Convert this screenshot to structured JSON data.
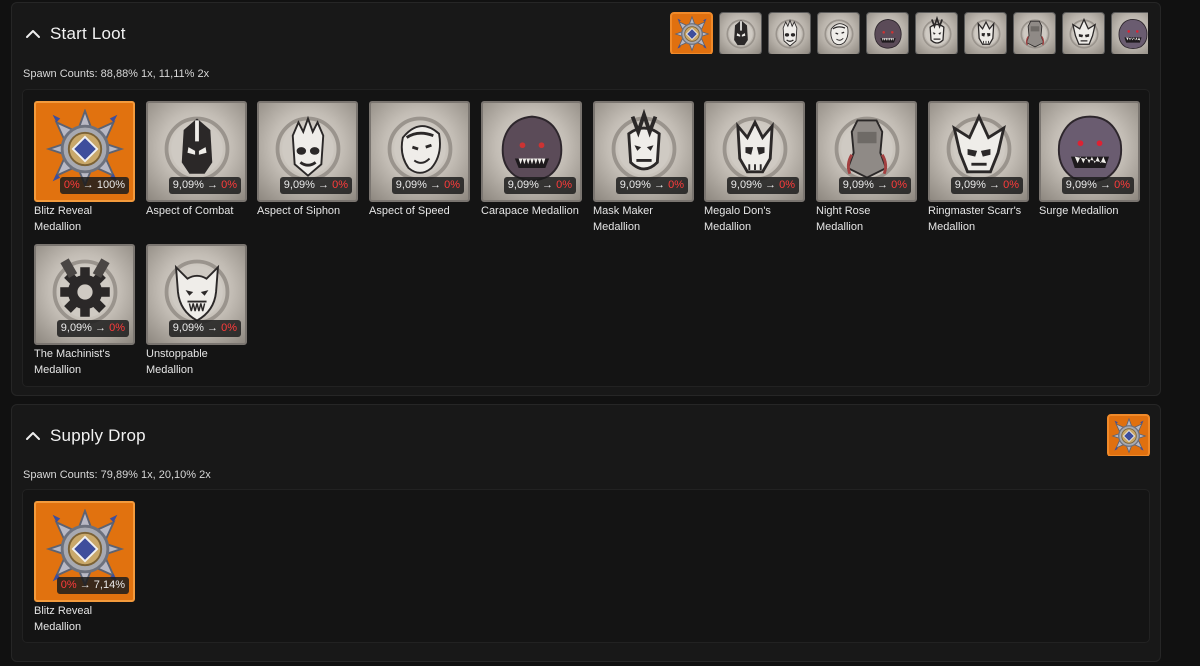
{
  "start_loot": {
    "title": "Start Loot",
    "spawn_counts": "Spawn Counts: 88,88% 1x, 11,11% 2x",
    "thumbs": [
      {
        "icon": "blitz-reveal-medallion-icon",
        "selected": true
      },
      {
        "icon": "aspect-of-combat-icon"
      },
      {
        "icon": "aspect-of-siphon-icon"
      },
      {
        "icon": "aspect-of-speed-icon"
      },
      {
        "icon": "carapace-medallion-icon"
      },
      {
        "icon": "mask-maker-medallion-icon"
      },
      {
        "icon": "megalo-dons-medallion-icon"
      },
      {
        "icon": "night-rose-medallion-icon"
      },
      {
        "icon": "ringmaster-scarrs-medallion-icon"
      },
      {
        "icon": "surge-medallion-icon"
      }
    ],
    "items": [
      {
        "name": "Blitz Reveal Medallion",
        "from": "0%",
        "arrow": "→",
        "to": "100%",
        "icon": "blitz-reveal-medallion-icon",
        "highlight": true
      },
      {
        "name": "Aspect of Combat",
        "from": "9,09%",
        "arrow": "→",
        "to": "0%",
        "icon": "aspect-of-combat-icon"
      },
      {
        "name": "Aspect of Siphon",
        "from": "9,09%",
        "arrow": "→",
        "to": "0%",
        "icon": "aspect-of-siphon-icon"
      },
      {
        "name": "Aspect of Speed",
        "from": "9,09%",
        "arrow": "→",
        "to": "0%",
        "icon": "aspect-of-speed-icon"
      },
      {
        "name": "Carapace Medallion",
        "from": "9,09%",
        "arrow": "→",
        "to": "0%",
        "icon": "carapace-medallion-icon"
      },
      {
        "name": "Mask Maker Medallion",
        "from": "9,09%",
        "arrow": "→",
        "to": "0%",
        "icon": "mask-maker-medallion-icon"
      },
      {
        "name": "Megalo Don's Medallion",
        "from": "9,09%",
        "arrow": "→",
        "to": "0%",
        "icon": "megalo-dons-medallion-icon"
      },
      {
        "name": "Night Rose Medallion",
        "from": "9,09%",
        "arrow": "→",
        "to": "0%",
        "icon": "night-rose-medallion-icon"
      },
      {
        "name": "Ringmaster Scarr's Medallion",
        "from": "9,09%",
        "arrow": "→",
        "to": "0%",
        "icon": "ringmaster-scarrs-medallion-icon"
      },
      {
        "name": "Surge Medallion",
        "from": "9,09%",
        "arrow": "→",
        "to": "0%",
        "icon": "surge-medallion-icon"
      },
      {
        "name": "The Machinist's Medallion",
        "from": "9,09%",
        "arrow": "→",
        "to": "0%",
        "icon": "machinists-medallion-icon"
      },
      {
        "name": "Unstoppable Medallion",
        "from": "9,09%",
        "arrow": "→",
        "to": "0%",
        "icon": "unstoppable-medallion-icon"
      }
    ]
  },
  "supply_drop": {
    "title": "Supply Drop",
    "spawn_counts": "Spawn Counts: 79,89% 1x, 20,10% 2x",
    "thumbs": [
      {
        "icon": "blitz-reveal-medallion-icon",
        "selected": true
      }
    ],
    "items": [
      {
        "name": "Blitz Reveal Medallion",
        "from": "0%",
        "arrow": "→",
        "to": "7,14%",
        "icon": "blitz-reveal-medallion-icon",
        "highlight": true
      }
    ]
  },
  "colors": {
    "background": "#111111",
    "panel": "#181818",
    "highlight_orange": "#e1720f",
    "negative_red": "#ff3b3b"
  }
}
